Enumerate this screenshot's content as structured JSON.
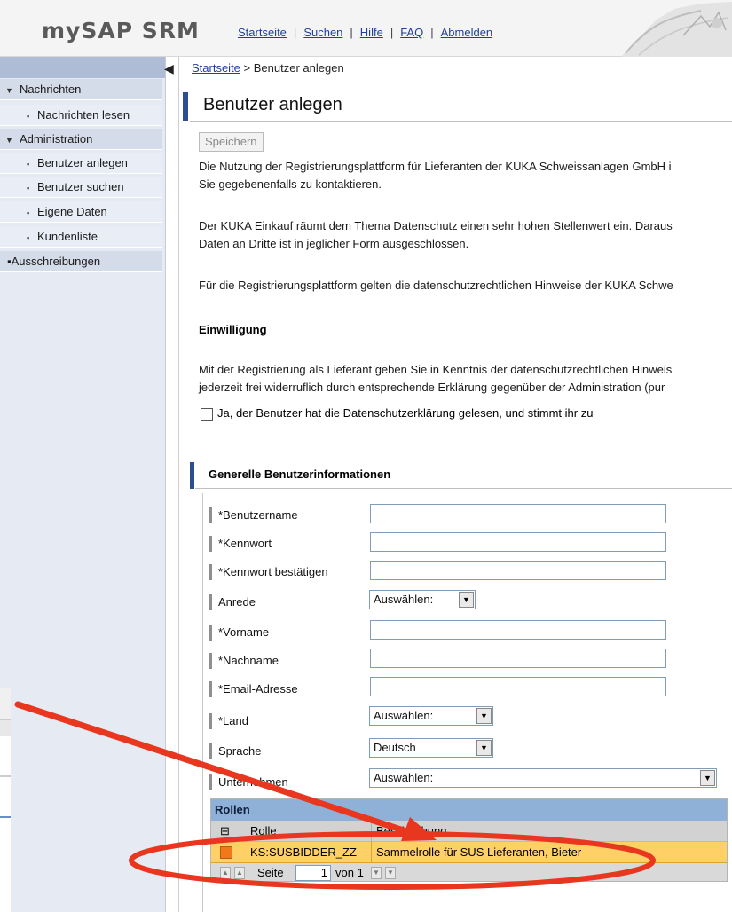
{
  "header": {
    "logo": "mySAP SRM",
    "nav": [
      "Startseite",
      "Suchen",
      "Hilfe",
      "FAQ",
      "Abmelden"
    ],
    "separator": "|"
  },
  "sidebar": {
    "items": [
      {
        "label": "Nachrichten",
        "kind": "group"
      },
      {
        "label": "Nachrichten lesen",
        "kind": "sub"
      },
      {
        "label": "Administration",
        "kind": "group"
      },
      {
        "label": "Benutzer anlegen",
        "kind": "sub"
      },
      {
        "label": "Benutzer suchen",
        "kind": "sub"
      },
      {
        "label": "Eigene Daten",
        "kind": "sub"
      },
      {
        "label": "Kundenliste",
        "kind": "sub"
      },
      {
        "label": "Ausschreibungen",
        "kind": "root"
      }
    ]
  },
  "breadcrumb": {
    "home": "Startseite",
    "separator": ">",
    "current": "Benutzer anlegen"
  },
  "page": {
    "title": "Benutzer anlegen",
    "save_label": "Speichern",
    "p1a": "Die Nutzung der Registrierungsplattform für Lieferanten der KUKA Schweissanlagen GmbH i",
    "p1b": "Sie gegebenenfalls zu kontaktieren.",
    "p2a": "Der KUKA Einkauf räumt dem Thema Datenschutz einen sehr hohen Stellenwert ein. Daraus",
    "p2b": "Daten an Dritte ist in jeglicher Form ausgeschlossen.",
    "p3": "Für die Registrierungsplattform gelten die datenschutzrechtlichen Hinweise der KUKA Schwe",
    "consent_heading": "Einwilligung",
    "p4a": "Mit der Registrierung als Lieferant geben Sie in Kenntnis der datenschutzrechtlichen Hinweis",
    "p4b": "jederzeit frei widerruflich durch entsprechende Erklärung gegenüber der Administration (pur",
    "consent_label": "Ja, der Benutzer hat die Datenschutzerklärung gelesen, und stimmt ihr zu"
  },
  "form": {
    "section_title": "Generelle Benutzerinformationen",
    "fields": {
      "username": "*Benutzername",
      "password": "*Kennwort",
      "password_confirm": "*Kennwort bestätigen",
      "salutation": "Anrede",
      "firstname": "*Vorname",
      "lastname": "*Nachname",
      "email": "*Email-Adresse",
      "country": "*Land",
      "language": "Sprache",
      "company": "Unternehmen"
    },
    "selects": {
      "salutation": "Auswählen:",
      "country": "Auswählen:",
      "language": "Deutsch",
      "company": "Auswählen:"
    }
  },
  "roles": {
    "title": "Rollen",
    "columns": [
      "Rolle",
      "Beschreibung"
    ],
    "rows": [
      {
        "role": "KS:SUSBIDDER_ZZ",
        "description": "Sammelrolle für SUS Lieferanten, Bieter"
      }
    ],
    "pager": {
      "label": "Seite",
      "page": "1",
      "of": "von 1"
    }
  },
  "colors": {
    "sidebar_header": "#aebcd6",
    "accent": "#2b4f8f",
    "roles_header": "#8fb0d7",
    "row_highlight": "#ffd066",
    "annotation": "#e8361f"
  },
  "icons": [
    "triangle-down-icon",
    "bullet-icon",
    "collapse-arrow-icon",
    "select-all-icon",
    "dropdown-arrow-icon",
    "page-first-icon",
    "page-prev-icon",
    "page-next-icon",
    "page-last-icon"
  ]
}
